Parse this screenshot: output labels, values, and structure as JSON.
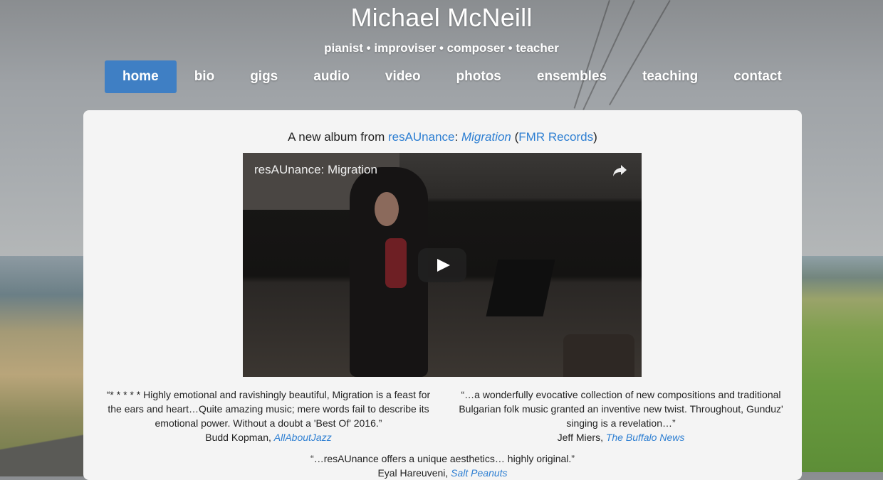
{
  "site": {
    "title": "Michael McNeill",
    "subtitle": "pianist • improviser • composer • teacher"
  },
  "nav": {
    "items": [
      {
        "label": "home"
      },
      {
        "label": "bio"
      },
      {
        "label": "gigs"
      },
      {
        "label": "audio"
      },
      {
        "label": "video"
      },
      {
        "label": "photos"
      },
      {
        "label": "ensembles"
      },
      {
        "label": "teaching"
      },
      {
        "label": "contact"
      }
    ],
    "active": "home",
    "active_color": "#3f7fc4"
  },
  "main": {
    "headline": {
      "prefix": "A new album from ",
      "artist": "resAUnance",
      "sep": ": ",
      "album": "Migration",
      "open_paren": " (",
      "label": "FMR Records",
      "close_paren": ")"
    },
    "video": {
      "title": "resAUnance: Migration",
      "share_icon": "share-icon",
      "play_icon": "play-icon"
    },
    "quotes": [
      {
        "text": "“* * * * * Highly emotional and ravishingly beautiful, Migration is a feast for the ears and heart…Quite amazing music; mere words fail to describe its emotional power. Without a doubt a 'Best Of' 2016.”",
        "author": "Budd Kopman, ",
        "source": "AllAboutJazz"
      },
      {
        "text": "“…a wonderfully evocative collection of new compositions and traditional Bulgarian folk music granted an inventive new twist. Throughout, Gunduz' singing is a revelation…”",
        "author": "Jeff Miers, ",
        "source": "The Buffalo News"
      },
      {
        "text": "“…resAUnance offers a unique aesthetics… highly original.”",
        "author": "Eyal Hareuveni, ",
        "source": "Salt Peanuts"
      }
    ]
  },
  "colors": {
    "link": "#2e7fd2",
    "panel": "#f4f4f4"
  }
}
